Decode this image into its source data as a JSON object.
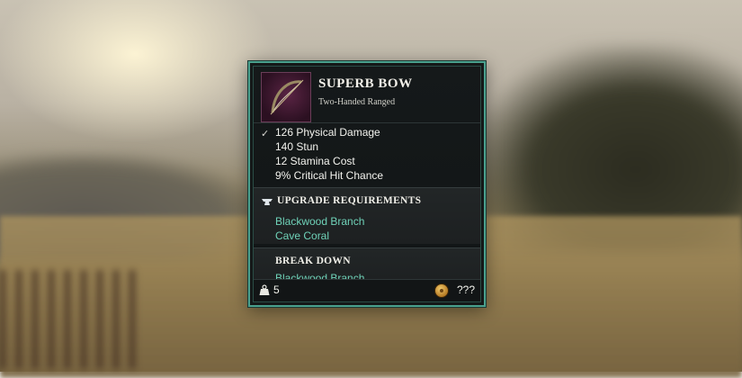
{
  "item": {
    "name": "SUPERB BOW",
    "type": "Two-Handed Ranged",
    "icon": "bow-icon"
  },
  "stats": [
    "126 Physical Damage",
    "140 Stun",
    "12 Stamina Cost",
    "9% Critical Hit Chance"
  ],
  "stats_check": "✓",
  "upgrade": {
    "title": "UPGRADE REQUIREMENTS",
    "materials": [
      "Blackwood Branch",
      "Cave Coral"
    ]
  },
  "break_down": {
    "title": "BREAK DOWN",
    "materials": [
      "Blackwood Branch"
    ]
  },
  "footer": {
    "weight": "5",
    "price": "???"
  },
  "colors": {
    "border_accent": "#4aa08d",
    "material_text": "#6fd2b8",
    "icon_background": "#5a2444"
  }
}
